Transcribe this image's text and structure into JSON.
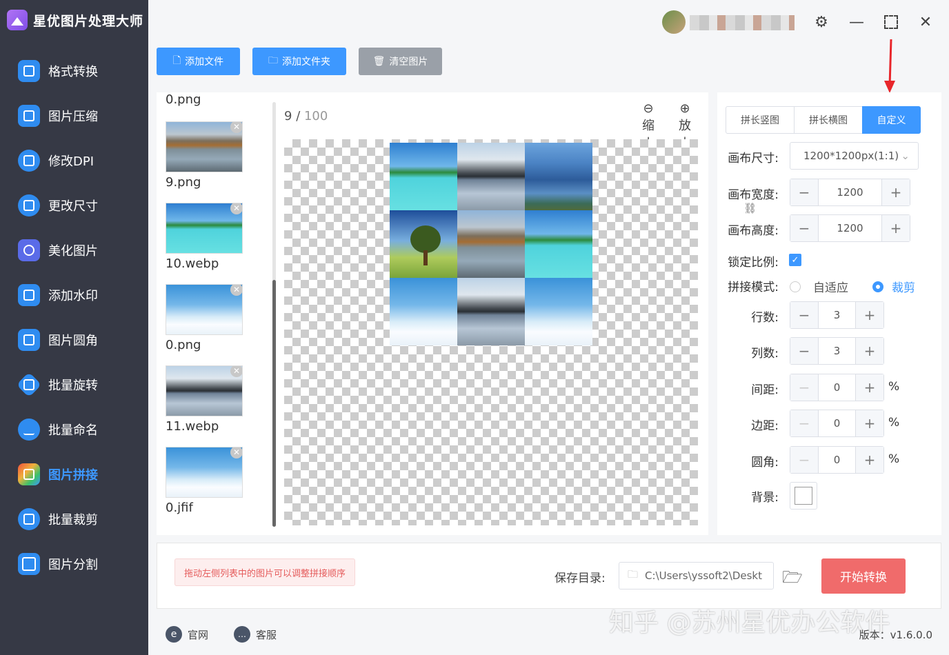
{
  "app": {
    "title": "星优图片处理大师"
  },
  "sidebar": {
    "items": [
      {
        "label": "格式转换",
        "icon": "image-convert-icon"
      },
      {
        "label": "图片压缩",
        "icon": "compress-icon"
      },
      {
        "label": "修改DPI",
        "icon": "dpi-icon"
      },
      {
        "label": "更改尺寸",
        "icon": "resize-icon"
      },
      {
        "label": "美化图片",
        "icon": "beautify-icon"
      },
      {
        "label": "添加水印",
        "icon": "watermark-icon"
      },
      {
        "label": "图片圆角",
        "icon": "round-corner-icon"
      },
      {
        "label": "批量旋转",
        "icon": "rotate-icon"
      },
      {
        "label": "批量命名",
        "icon": "rename-icon"
      },
      {
        "label": "图片拼接",
        "icon": "stitch-icon",
        "active": true
      },
      {
        "label": "批量裁剪",
        "icon": "crop-icon"
      },
      {
        "label": "图片分割",
        "icon": "split-icon"
      }
    ]
  },
  "toolbar": {
    "add_file": "添加文件",
    "add_folder": "添加文件夹",
    "clear": "清空图片"
  },
  "filelist": [
    {
      "name": "0.png"
    },
    {
      "name": "9.png"
    },
    {
      "name": "10.webp"
    },
    {
      "name": "0.png"
    },
    {
      "name": "11.webp"
    },
    {
      "name": "0.jfif"
    }
  ],
  "preview": {
    "current": "9",
    "total": "100",
    "zoom_out": "缩小",
    "zoom_in": "放大"
  },
  "settings": {
    "tabs": [
      "拼长竖图",
      "拼长横图",
      "自定义"
    ],
    "active_tab": "自定义",
    "canvas_size_label": "画布尺寸:",
    "canvas_size_value": "1200*1200px(1:1)",
    "width_label": "画布宽度:",
    "width_value": "1200",
    "height_label": "画布高度:",
    "height_value": "1200",
    "lock_label": "锁定比例:",
    "lock_checked": true,
    "mode_label": "拼接模式:",
    "mode_fit": "自适应",
    "mode_crop": "裁剪",
    "rows_label": "行数:",
    "rows_value": "3",
    "cols_label": "列数:",
    "cols_value": "3",
    "gap_label": "间距:",
    "gap_value": "0",
    "margin_label": "边距:",
    "margin_value": "0",
    "radius_label": "圆角:",
    "radius_value": "0",
    "percent": "%",
    "bg_label": "背景:",
    "minus": "−",
    "plus": "+"
  },
  "bottom": {
    "hint": "拖动左侧列表中的图片可以调整拼接顺序",
    "save_label": "保存目录:",
    "save_path": "C:\\Users\\yssoft2\\Deskt",
    "start": "开始转换"
  },
  "footer": {
    "site": "官网",
    "service": "客服",
    "watermark": "知乎 @苏州星优办公软件",
    "version": "版本：v1.6.0.0"
  },
  "colors": {
    "accent": "#3d98ff",
    "sidebar": "#363945",
    "start_btn": "#f06b6b",
    "arrow": "#e8262b"
  }
}
